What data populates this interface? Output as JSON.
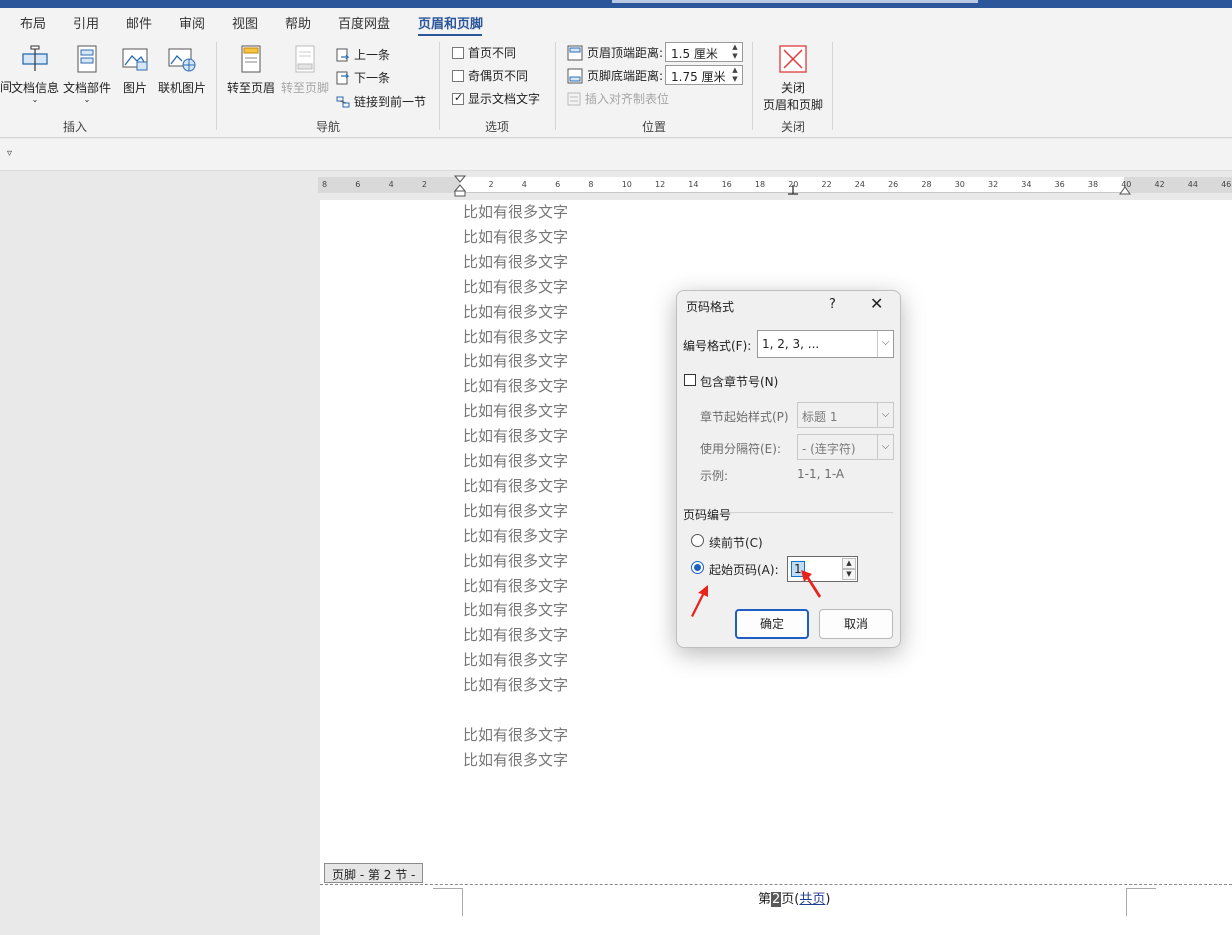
{
  "ribbon_tabs": [
    "布局",
    "引用",
    "邮件",
    "审阅",
    "视图",
    "帮助",
    "百度网盘",
    "页眉和页脚"
  ],
  "insert_group": {
    "items": [
      "",
      "文档信息",
      "文档部件",
      "图片",
      "联机图片"
    ],
    "label": "插入"
  },
  "nav_group": {
    "goto_header": "转至页眉",
    "goto_footer": "转至页脚",
    "prev": "上一条",
    "next": "下一条",
    "link_prev": "链接到前一节",
    "label": "导航"
  },
  "options_group": {
    "first_page_diff": "首页不同",
    "odd_even_diff": "奇偶页不同",
    "show_doc_text": "显示文档文字",
    "label": "选项"
  },
  "position_group": {
    "header_dist_label": "页眉顶端距离:",
    "header_dist_value": "1.5 厘米",
    "footer_dist_label": "页脚底端距离:",
    "footer_dist_value": "1.75 厘米",
    "insert_align_tab": "插入对齐制表位",
    "label": "位置"
  },
  "close_group": {
    "close_line1": "关闭",
    "close_line2": "页眉和页脚",
    "label": "关闭"
  },
  "ruler_ticks": [
    "8",
    "6",
    "4",
    "2",
    "",
    "2",
    "4",
    "6",
    "8",
    "10",
    "12",
    "14",
    "16",
    "18",
    "20",
    "22",
    "24",
    "26",
    "28",
    "30",
    "32",
    "34",
    "36",
    "38",
    "40",
    "42",
    "44",
    "46"
  ],
  "document": {
    "lines": [
      "比如有很多文字",
      "比如有很多文字",
      "比如有很多文字",
      "比如有很多文字",
      "比如有很多文字",
      "比如有很多文字",
      "比如有很多文字",
      "比如有很多文字",
      "比如有很多文字",
      "比如有很多文字",
      "比如有很多文字",
      "比如有很多文字",
      "比如有很多文字",
      "比如有很多文字",
      "比如有很多文字",
      "比如有很多文字",
      "比如有很多文字",
      "比如有很多文字",
      "比如有很多文字",
      "比如有很多文字",
      "",
      "比如有很多文字",
      "比如有很多文字"
    ],
    "footer_tag": "页脚 - 第 2 节 -",
    "footer_prefix": "第",
    "footer_page_num": "2",
    "footer_mid": "页(",
    "footer_total": "共页",
    "footer_suffix": ")"
  },
  "dialog": {
    "title": "页码格式",
    "help": "?",
    "close": "✕",
    "number_format_label": "编号格式(F):",
    "number_format_value": "1, 2, 3, ...",
    "include_chapter_label": "包含章节号(N)",
    "chapter_style_label": "章节起始样式(P)",
    "chapter_style_value": "标题 1",
    "separator_label": "使用分隔符(E):",
    "separator_value": "-  (连字符)",
    "example_label": "示例:",
    "example_value": "1-1, 1-A",
    "page_numbering_heading": "页码编号",
    "continue_label": "续前节(C)",
    "start_at_label": "起始页码(A):",
    "start_at_value": "1",
    "ok_label": "确定",
    "cancel_label": "取消"
  },
  "colors": {
    "accent": "#2b579a",
    "arrow": "#e8231b",
    "radio": "#1f5fbf"
  }
}
